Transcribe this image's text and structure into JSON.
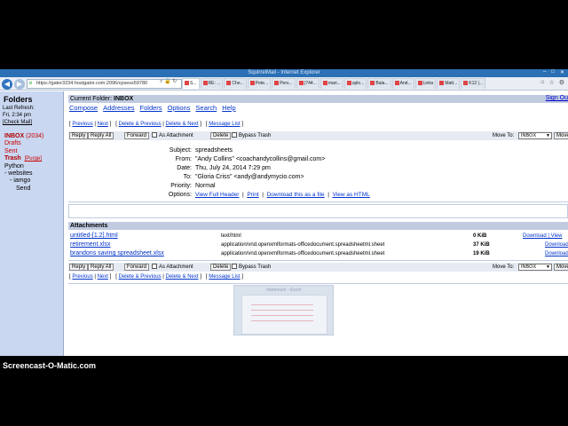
{
  "window": {
    "title": "SquirrelMail - Internet Explorer",
    "controls": [
      "–",
      "□",
      "✕"
    ]
  },
  "browser": {
    "url": "https://gator3234.hostgator.com:2096/cpsess59780",
    "tabs": [
      {
        "label": "S...",
        "active": true
      },
      {
        "label": "RE: ...",
        "active": false
      },
      {
        "label": "Che...",
        "active": false
      },
      {
        "label": "Pete...",
        "active": false
      },
      {
        "label": "Pers...",
        "active": false
      },
      {
        "label": "(744...",
        "active": false
      },
      {
        "label": "mari...",
        "active": false
      },
      {
        "label": "uplo...",
        "active": false
      },
      {
        "label": "Bala...",
        "active": false
      },
      {
        "label": "And...",
        "active": false
      },
      {
        "label": "Links",
        "active": false
      },
      {
        "label": "Matt...",
        "active": false
      },
      {
        "label": "K12 |...",
        "active": false
      }
    ]
  },
  "sidebar": {
    "heading": "Folders",
    "last_refresh_label": "Last Refresh:",
    "last_refresh_time": "Fri, 2:34 pm",
    "check_mail": "[Check Mail]",
    "inbox_label": "INBOX",
    "inbox_count": "(2034)",
    "drafts": "Drafts",
    "sent": "Sent",
    "trash": "Trash",
    "purge": "[Purge]",
    "python": "Python",
    "websites": "- websites",
    "iamgo": "- iamgo",
    "send": "Send"
  },
  "main": {
    "current_folder_label": "Current Folder:",
    "current_folder": "INBOX",
    "sign_out": "Sign Ou",
    "menu": [
      "Compose",
      "Addresses",
      "Folders",
      "Options",
      "Search",
      "Help"
    ]
  },
  "nav": {
    "previous": "Previous",
    "next": "Next",
    "delete_previous": "Delete & Previous",
    "delete_next": "Delete & Next",
    "message_list": "Message List"
  },
  "actions": {
    "reply": "Reply",
    "reply_all": "Reply All",
    "forward": "Forward",
    "as_attachment": "As Attachment",
    "delete": "Delete",
    "bypass_trash": "Bypass Trash",
    "move_to": "Move To:",
    "move_select": "INBOX",
    "move_btn": "Move"
  },
  "message": {
    "subject_label": "Subject:",
    "subject": "spreadsheets",
    "from_label": "From:",
    "from": "\"Andy Collins\" <coachandycollins@gmail.com>",
    "date_label": "Date:",
    "date": "Thu, July 24, 2014 7:29 pm",
    "to_label": "To:",
    "to": "\"Gloria Criss\" <andy@andymycio.com>",
    "priority_label": "Priority:",
    "priority": "Normal",
    "options_label": "Options:",
    "view_full_header": "View Full Header",
    "print": "Print",
    "download_as_file": "Download this as a file",
    "view_as_html": "View as HTML"
  },
  "attachments": {
    "heading": "Attachments",
    "rows": [
      {
        "name": "untitled-[1.2].html",
        "type": "text/html",
        "size": "0 KiB",
        "actions": "Download | View"
      },
      {
        "name": "retirement.xlsx",
        "type": "application/vnd.openxmlformats-officedocument.spreadsheetml.sheet",
        "size": "37 KiB",
        "actions": "Download"
      },
      {
        "name": "brandons saving spreadsheet.xlsx",
        "type": "application/vnd.openxmlformats-officedocument.spreadsheetml.sheet",
        "size": "19 KiB",
        "actions": "Download"
      }
    ]
  },
  "thumbnail": {
    "title": "retirement - Excel"
  },
  "watermark": "Screencast-O-Matic.com"
}
